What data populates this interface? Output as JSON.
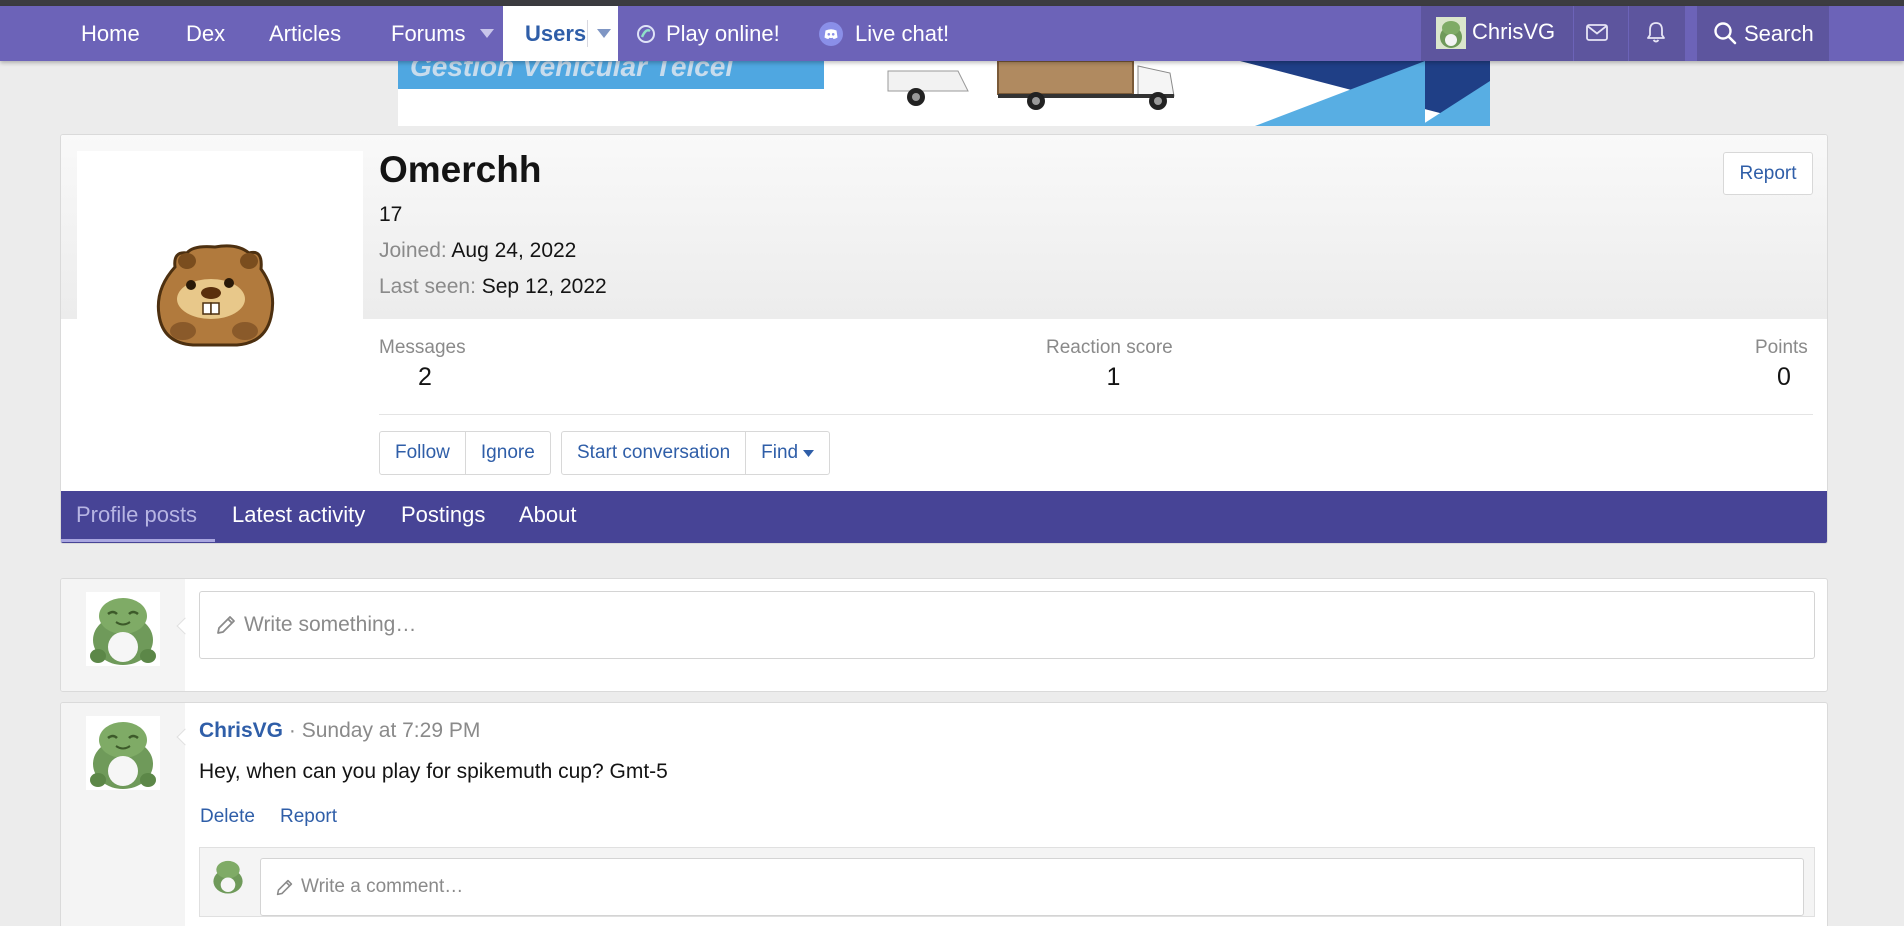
{
  "nav": {
    "items": [
      "Home",
      "Dex",
      "Articles",
      "Forums",
      "Users",
      "Play online!",
      "Live chat!"
    ],
    "username": "ChrisVG",
    "search_label": "Search"
  },
  "banner": {
    "text": "Gestión Vehicular Telcel"
  },
  "profile": {
    "name": "Omerchh",
    "title": "17",
    "joined_label": "Joined:",
    "joined_value": "Aug 24, 2022",
    "last_seen_label": "Last seen:",
    "last_seen_value": "Sep 12, 2022",
    "report_label": "Report",
    "stats": [
      {
        "label": "Messages",
        "value": "2"
      },
      {
        "label": "Reaction score",
        "value": "1"
      },
      {
        "label": "Points",
        "value": "0"
      }
    ],
    "buttons": [
      "Follow",
      "Ignore",
      "Start conversation",
      "Find"
    ],
    "tabs": [
      "Profile posts",
      "Latest activity",
      "Postings",
      "About"
    ]
  },
  "post_form": {
    "placeholder": "Write something…"
  },
  "post": {
    "author": "ChrisVG",
    "separator": "·",
    "time": "Sunday at 7:29 PM",
    "body": "Hey, when can you play for spikemuth cup? Gmt-5",
    "actions": [
      "Delete",
      "Report"
    ],
    "comment_placeholder": "Write a comment…"
  },
  "colors": {
    "nav_bg": "#6c63b8",
    "tabs_bg": "#474496",
    "link": "#2f5ea8"
  },
  "icons": [
    "caret-down-icon",
    "bulbapedia-icon",
    "discord-icon",
    "envelope-icon",
    "bell-icon",
    "search-icon",
    "pencil-icon"
  ]
}
